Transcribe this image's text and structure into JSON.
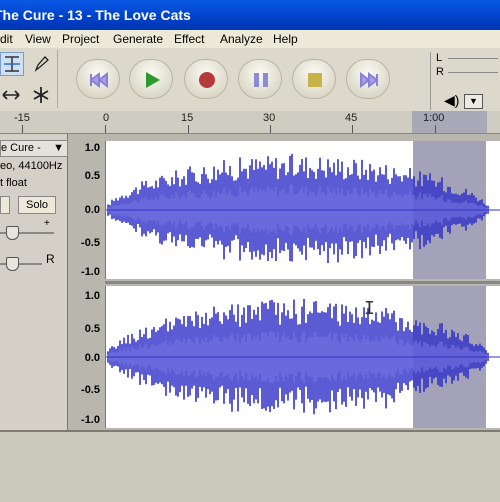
{
  "window": {
    "title": "The Cure - 13 - The Love Cats"
  },
  "menu": [
    "Edit",
    "View",
    "Project",
    "Generate",
    "Effect",
    "Analyze",
    "Help"
  ],
  "menu_visible": [
    "dit",
    "View",
    "Project",
    "Generate",
    "Effect",
    "Analyze",
    "Help"
  ],
  "tools": {
    "select": "select-tool",
    "draw": "pencil-tool",
    "timeshift": "timeshift-tool",
    "multi": "multi-tool"
  },
  "transport": [
    "skip-start",
    "play",
    "record",
    "pause",
    "stop",
    "skip-end"
  ],
  "meter": {
    "left": "L",
    "right": "R"
  },
  "ruler": {
    "ticks": [
      "-15",
      "0",
      "15",
      "30",
      "45",
      "1:00"
    ]
  },
  "track": {
    "name": "e Cure -",
    "info1": "eo, 44100Hz",
    "info2": "t float",
    "mute_label": "",
    "solo_label": "Solo",
    "pan_left": "",
    "pan_right": "R",
    "gain_plus": "+"
  },
  "scale": {
    "top": "1.0",
    "upper": "0.5",
    "mid": "0.0",
    "lower": "-0.5",
    "bottom": "-1.0"
  },
  "colors": {
    "waveform": "#3232c8",
    "waveform_rms": "#6464dc",
    "selection": "#a3a2b9"
  }
}
